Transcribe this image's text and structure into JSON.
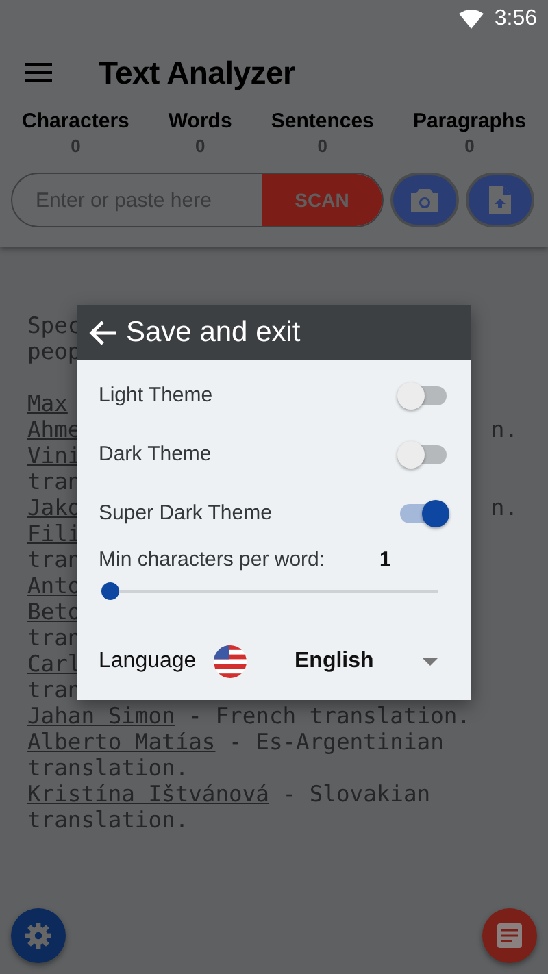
{
  "status_bar": {
    "time": "3:56"
  },
  "app_bar": {
    "title": "Text Analyzer"
  },
  "stats": [
    {
      "label": "Characters",
      "value": "0"
    },
    {
      "label": "Words",
      "value": "0"
    },
    {
      "label": "Sentences",
      "value": "0"
    },
    {
      "label": "Paragraphs",
      "value": "0"
    }
  ],
  "input": {
    "placeholder": "Enter or paste here",
    "button": "SCAN"
  },
  "background_text": [
    {
      "parts": [
        {
          "text": "Spec",
          "link": false
        }
      ]
    },
    {
      "parts": [
        {
          "text": "peop",
          "link": false
        }
      ]
    },
    {
      "new_paragraph": true,
      "parts": [
        {
          "text": "Max",
          "link": true
        }
      ]
    },
    {
      "parts": [
        {
          "text": "Ahme",
          "link": true
        }
      ],
      "right": "n."
    },
    {
      "parts": [
        {
          "text": "Vini",
          "link": true
        }
      ]
    },
    {
      "parts": [
        {
          "text": "tran",
          "link": false
        }
      ]
    },
    {
      "parts": [
        {
          "text": "Jako",
          "link": true
        }
      ],
      "right": "n."
    },
    {
      "parts": [
        {
          "text": "Fili",
          "link": true
        }
      ]
    },
    {
      "parts": [
        {
          "text": "tran",
          "link": false
        }
      ]
    },
    {
      "parts": [
        {
          "text": "Anto",
          "link": true
        }
      ]
    },
    {
      "parts": [
        {
          "text": "Beto",
          "link": true
        }
      ]
    },
    {
      "parts": [
        {
          "text": "tran",
          "link": false
        }
      ]
    },
    {
      "parts": [
        {
          "text": "Carl",
          "link": true
        }
      ]
    },
    {
      "parts": [
        {
          "text": "tran",
          "link": false
        }
      ]
    },
    {
      "parts": [
        {
          "text": "Jahan Simon",
          "link": true
        },
        {
          "text": " - French translation.",
          "link": false
        }
      ]
    },
    {
      "parts": [
        {
          "text": "Alberto Matías",
          "link": true
        },
        {
          "text": " - Es-Argentinian",
          "link": false
        }
      ]
    },
    {
      "parts": [
        {
          "text": "translation.",
          "link": false
        }
      ]
    },
    {
      "parts": [
        {
          "text": "Kristína Ištvánová",
          "link": true
        },
        {
          "text": " - Slovakian",
          "link": false
        }
      ]
    },
    {
      "parts": [
        {
          "text": "translation.",
          "link": false
        }
      ]
    }
  ],
  "dialog": {
    "title": "Save and exit",
    "toggles": [
      {
        "label": "Light Theme",
        "on": false
      },
      {
        "label": "Dark Theme",
        "on": false
      },
      {
        "label": "Super Dark Theme",
        "on": true
      }
    ],
    "slider": {
      "label": "Min characters per word:",
      "value": "1",
      "level": 0
    },
    "language": {
      "label": "Language",
      "value": "English"
    }
  }
}
